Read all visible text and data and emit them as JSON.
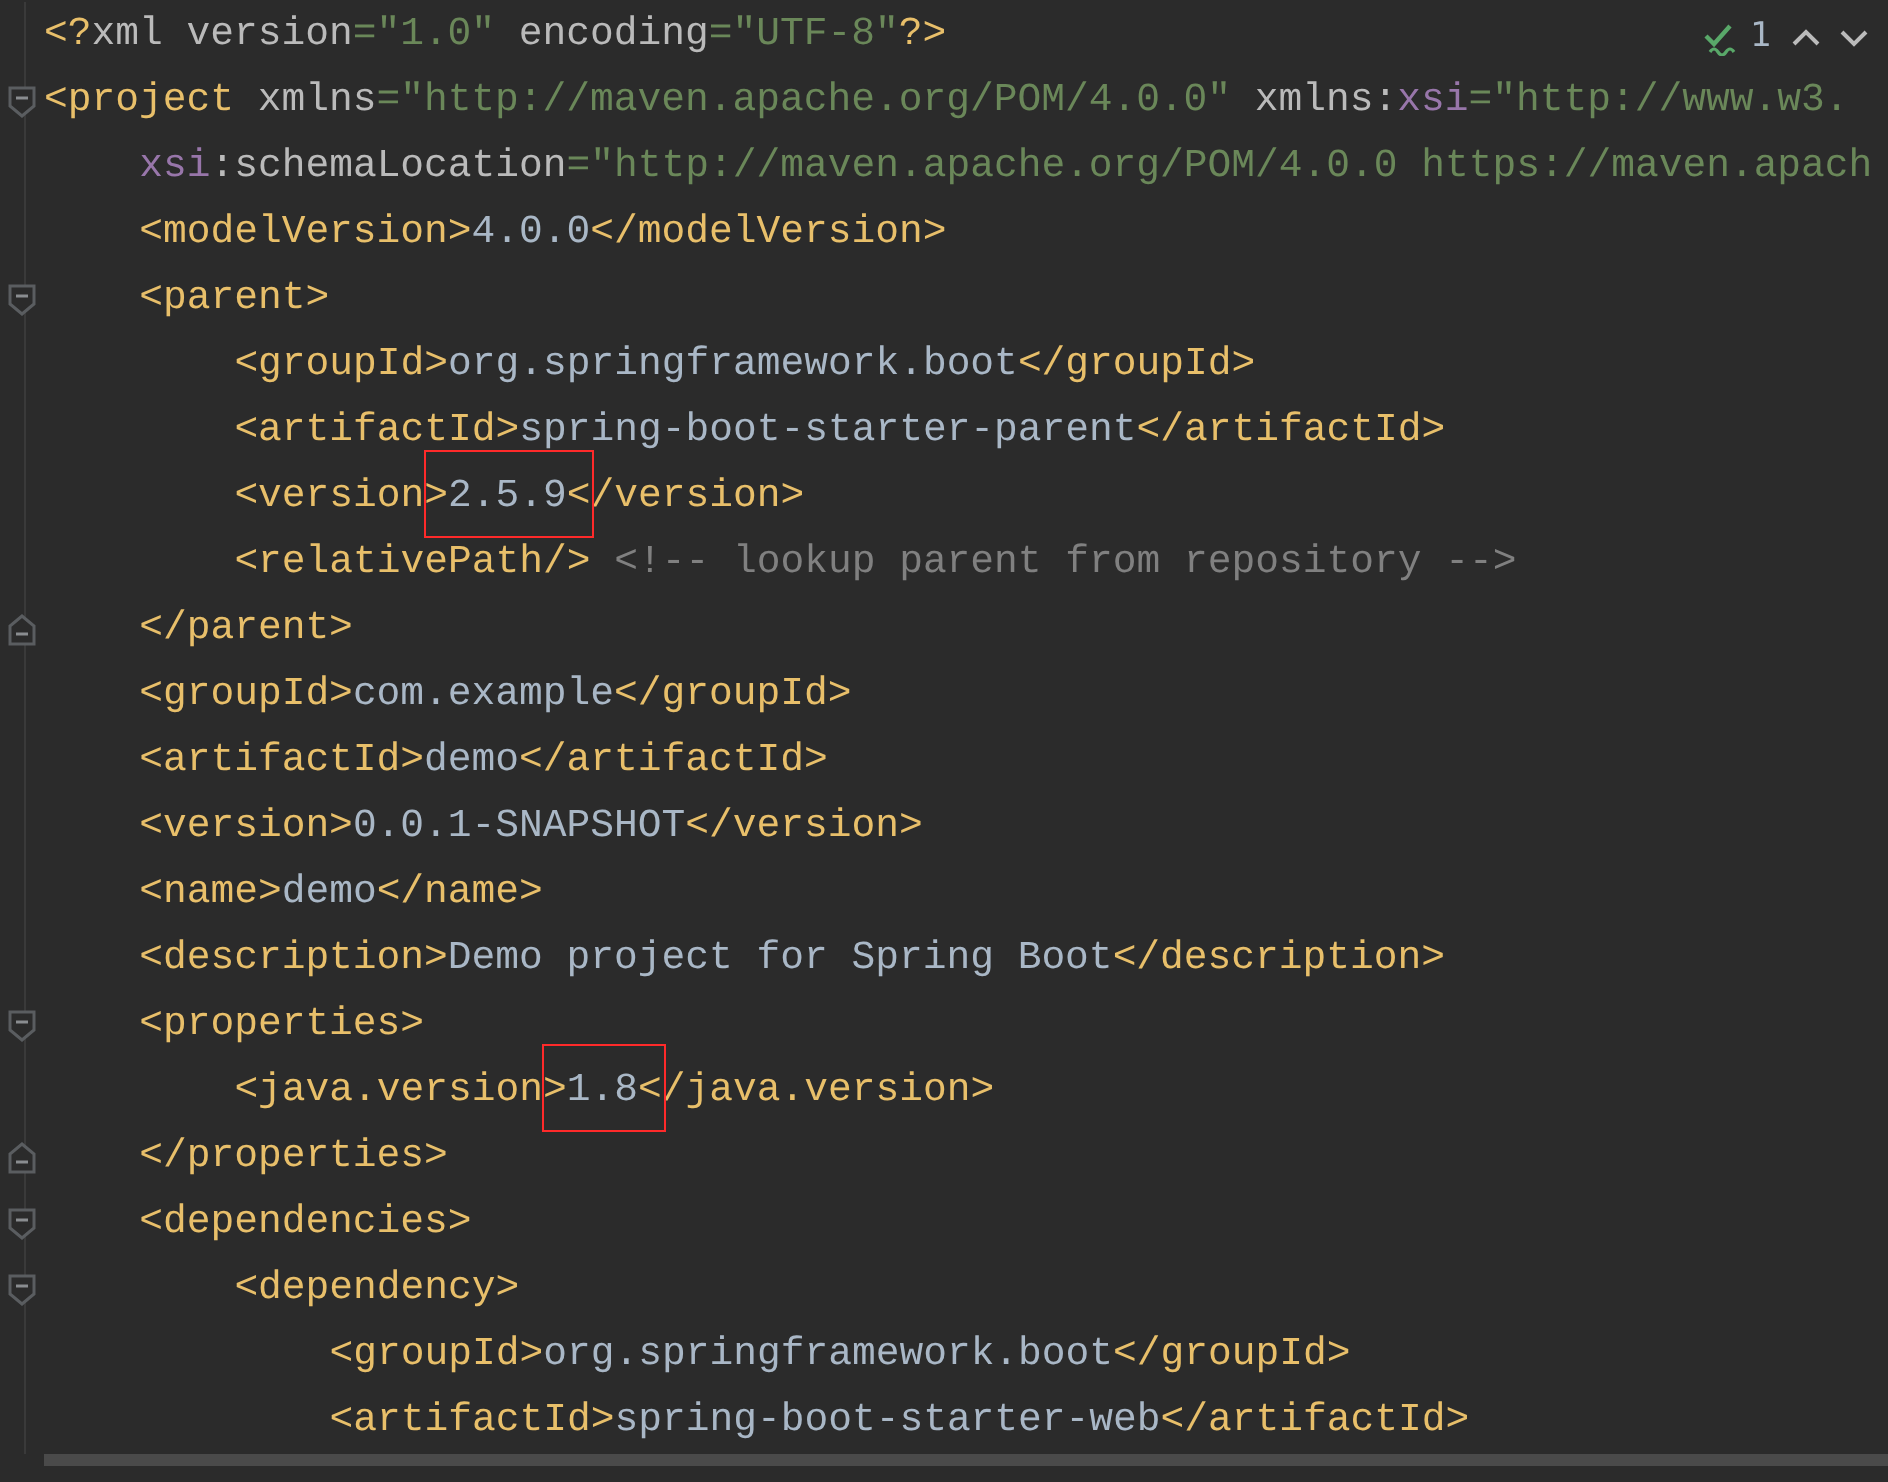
{
  "inspection": {
    "count": "1"
  },
  "lines": [
    {
      "kind": "plain",
      "tokens": [
        {
          "kind": "tag",
          "text": "<?"
        },
        {
          "kind": "attr",
          "text": "xml version"
        },
        {
          "kind": "value",
          "text": "=\"1.0\""
        },
        {
          "kind": "attr",
          "text": " encoding"
        },
        {
          "kind": "value",
          "text": "=\"UTF-8\""
        },
        {
          "kind": "tag",
          "text": "?>"
        }
      ]
    },
    {
      "kind": "fold-start",
      "tokens": [
        {
          "kind": "tag",
          "text": "<project"
        },
        {
          "kind": "attr",
          "text": " xmlns"
        },
        {
          "kind": "value",
          "text": "=\"http://maven.apache.org/POM/4.0.0\""
        },
        {
          "kind": "attr",
          "text": " xmlns:"
        },
        {
          "kind": "ns",
          "text": "xsi"
        },
        {
          "kind": "value",
          "text": "=\"http://www.w3."
        }
      ],
      "children": [
        {
          "kind": "plain",
          "tokens": [
            {
              "kind": "ns",
              "text": "xsi"
            },
            {
              "kind": "attr",
              "text": ":schemaLocation"
            },
            {
              "kind": "value",
              "text": "=\"http://maven.apache.org/POM/4.0.0 https://maven.apach"
            }
          ]
        },
        {
          "kind": "plain",
          "tokens": [
            {
              "kind": "tag",
              "text": "<modelVersion>"
            },
            {
              "kind": "text",
              "text": "4.0.0"
            },
            {
              "kind": "tag",
              "text": "</modelVersion>"
            }
          ]
        },
        {
          "kind": "fold-start",
          "tokens": [
            {
              "kind": "tag",
              "text": "<parent>"
            }
          ],
          "children": [
            {
              "kind": "plain",
              "tokens": [
                {
                  "kind": "tag",
                  "text": "<groupId>"
                },
                {
                  "kind": "text",
                  "text": "org.springframework.boot"
                },
                {
                  "kind": "tag",
                  "text": "</groupId>"
                }
              ]
            },
            {
              "kind": "plain",
              "tokens": [
                {
                  "kind": "tag",
                  "text": "<artifactId>"
                },
                {
                  "kind": "text",
                  "text": "spring-boot-starter-parent"
                },
                {
                  "kind": "tag",
                  "text": "</artifactId>"
                }
              ]
            },
            {
              "kind": "plain",
              "tokens": [
                {
                  "kind": "tag",
                  "text": "<version>"
                },
                {
                  "kind": "text",
                  "text": "2.5.9",
                  "boxed": true
                },
                {
                  "kind": "tag",
                  "text": "</version>"
                }
              ]
            },
            {
              "kind": "plain",
              "tokens": [
                {
                  "kind": "tag",
                  "text": "<relativePath/>"
                },
                {
                  "kind": "comment",
                  "text": " <!-- lookup parent from repository -->"
                }
              ]
            }
          ]
        },
        {
          "kind": "fold-end",
          "tokens": [
            {
              "kind": "tag",
              "text": "</parent>"
            }
          ]
        },
        {
          "kind": "plain",
          "tokens": [
            {
              "kind": "tag",
              "text": "<groupId>"
            },
            {
              "kind": "text",
              "text": "com.example"
            },
            {
              "kind": "tag",
              "text": "</groupId>"
            }
          ]
        },
        {
          "kind": "plain",
          "tokens": [
            {
              "kind": "tag",
              "text": "<artifactId>"
            },
            {
              "kind": "text",
              "text": "demo"
            },
            {
              "kind": "tag",
              "text": "</artifactId>"
            }
          ]
        },
        {
          "kind": "plain",
          "tokens": [
            {
              "kind": "tag",
              "text": "<version>"
            },
            {
              "kind": "text",
              "text": "0.0.1-SNAPSHOT"
            },
            {
              "kind": "tag",
              "text": "</version>"
            }
          ]
        },
        {
          "kind": "plain",
          "tokens": [
            {
              "kind": "tag",
              "text": "<name>"
            },
            {
              "kind": "text",
              "text": "demo"
            },
            {
              "kind": "tag",
              "text": "</name>"
            }
          ]
        },
        {
          "kind": "plain",
          "tokens": [
            {
              "kind": "tag",
              "text": "<description>"
            },
            {
              "kind": "text",
              "text": "Demo project for Spring Boot"
            },
            {
              "kind": "tag",
              "text": "</description>"
            }
          ]
        },
        {
          "kind": "fold-start",
          "tokens": [
            {
              "kind": "tag",
              "text": "<properties>"
            }
          ],
          "children": [
            {
              "kind": "plain",
              "tokens": [
                {
                  "kind": "tag",
                  "text": "<java.version>"
                },
                {
                  "kind": "text",
                  "text": "1.8",
                  "boxed": true
                },
                {
                  "kind": "tag",
                  "text": "</java.version>"
                }
              ]
            }
          ]
        },
        {
          "kind": "fold-end",
          "tokens": [
            {
              "kind": "tag",
              "text": "</properties>"
            }
          ]
        },
        {
          "kind": "fold-start",
          "tokens": [
            {
              "kind": "tag",
              "text": "<dependencies>"
            }
          ],
          "children": [
            {
              "kind": "fold-start",
              "tokens": [
                {
                  "kind": "tag",
                  "text": "<dependency>"
                }
              ],
              "children": [
                {
                  "kind": "plain",
                  "tokens": [
                    {
                      "kind": "tag",
                      "text": "<groupId>"
                    },
                    {
                      "kind": "text",
                      "text": "org.springframework.boot"
                    },
                    {
                      "kind": "tag",
                      "text": "</groupId>"
                    }
                  ]
                },
                {
                  "kind": "plain",
                  "tokens": [
                    {
                      "kind": "tag",
                      "text": "<artifactId>"
                    },
                    {
                      "kind": "text",
                      "text": "spring-boot-starter-web"
                    },
                    {
                      "kind": "tag",
                      "text": "</artifactId>"
                    }
                  ]
                }
              ]
            }
          ]
        }
      ]
    }
  ]
}
